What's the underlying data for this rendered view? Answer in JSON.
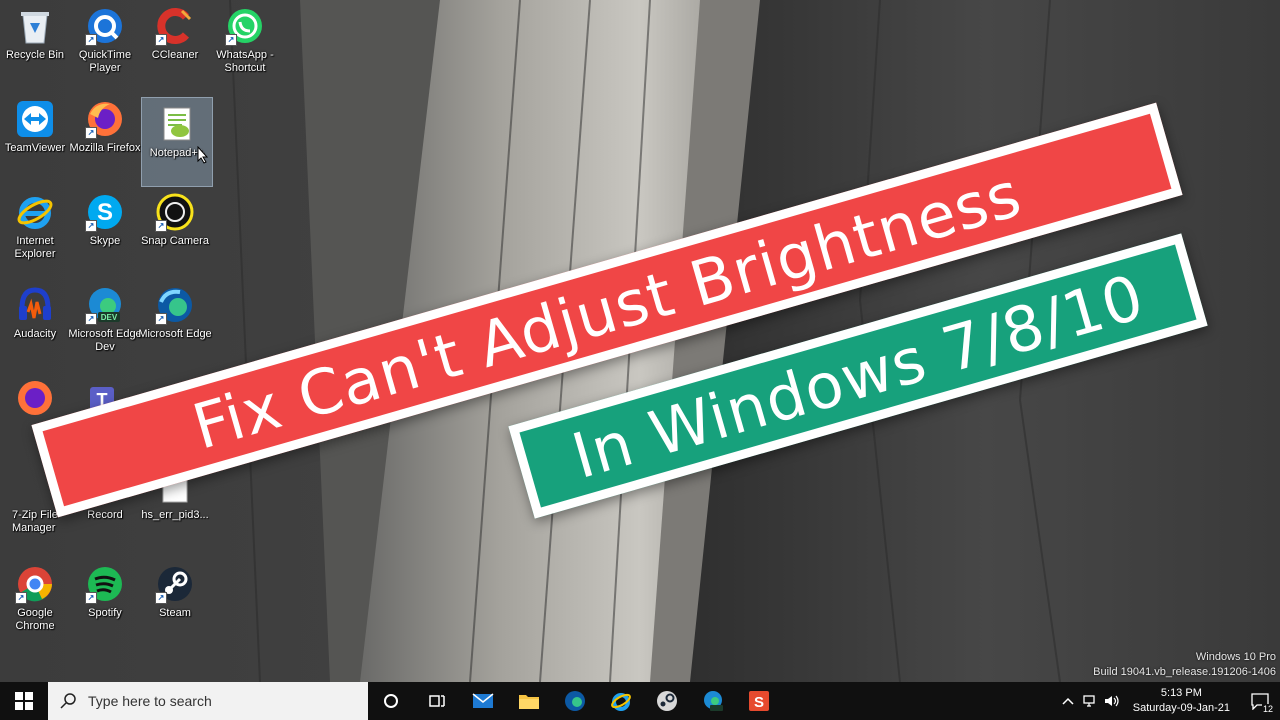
{
  "desktop": {
    "icons": [
      {
        "label": "Recycle Bin",
        "icon": "recycle-bin-icon"
      },
      {
        "label": "QuickTime Player",
        "icon": "quicktime-icon"
      },
      {
        "label": "CCleaner",
        "icon": "ccleaner-icon"
      },
      {
        "label": "WhatsApp - Shortcut",
        "icon": "whatsapp-icon"
      },
      {
        "label": "TeamViewer",
        "icon": "teamviewer-icon"
      },
      {
        "label": "Mozilla Firefox",
        "icon": "firefox-icon"
      },
      {
        "label": "Notepad++",
        "icon": "notepad-plus-plus-icon"
      },
      {
        "label": "Internet Explorer",
        "icon": "internet-explorer-icon"
      },
      {
        "label": "Skype",
        "icon": "skype-icon"
      },
      {
        "label": "Snap Camera",
        "icon": "snap-camera-icon"
      },
      {
        "label": "Audacity",
        "icon": "audacity-icon"
      },
      {
        "label": "Microsoft Edge Dev",
        "icon": "edge-dev-icon"
      },
      {
        "label": "Microsoft Edge",
        "icon": "edge-icon"
      },
      {
        "label": "7-Zip File Manager",
        "icon": "7zip-icon"
      },
      {
        "label": "Record",
        "icon": "record-icon"
      },
      {
        "label": "hs_err_pid3...",
        "icon": "text-file-icon"
      },
      {
        "label": "Google Chrome",
        "icon": "chrome-icon"
      },
      {
        "label": "Spotify",
        "icon": "spotify-icon"
      },
      {
        "label": "Steam",
        "icon": "steam-icon"
      }
    ]
  },
  "banner": {
    "line1": "Fix Can't Adjust Brightness",
    "line2": "In Windows 7/8/10",
    "line1_color": "#f04646",
    "line2_color": "#17a17c"
  },
  "watermark": {
    "edition": "Windows 10 Pro",
    "build": "Build 19041.vb_release.191206-1406"
  },
  "taskbar": {
    "search_placeholder": "Type here to search",
    "time": "5:13 PM",
    "date": "Saturday-09-Jan-21",
    "notification_count": "12",
    "apps": [
      "cortana-circle-icon",
      "task-view-icon",
      "mail-icon",
      "file-explorer-icon",
      "edge-icon",
      "internet-explorer-icon",
      "steam-icon",
      "edge-dev-icon",
      "snagit-icon"
    ]
  }
}
